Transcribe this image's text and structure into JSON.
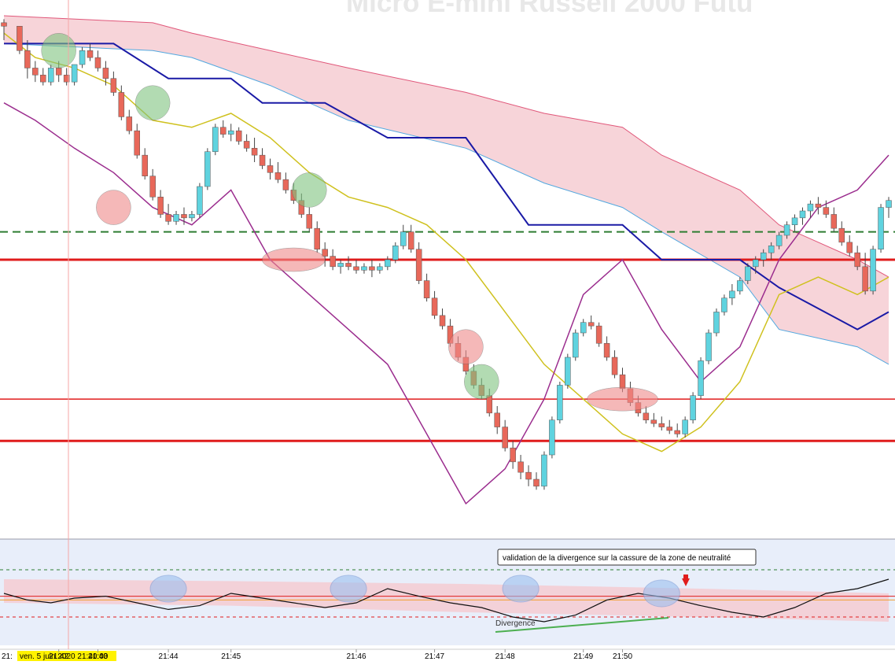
{
  "chart_data": {
    "type": "candlestick",
    "title": "Micro E-mini Russell 2000 Futu",
    "x_axis": {
      "cursor_label": "ven. 5 juin 2020 21:40:00",
      "first_tick_fragment": "21:",
      "ticks": [
        {
          "label": "21:42",
          "t": 8
        },
        {
          "label": "21:43",
          "t": 13
        },
        {
          "label": "21:44",
          "t": 22
        },
        {
          "label": "21:45",
          "t": 30
        },
        {
          "label": "21:46",
          "t": 46
        },
        {
          "label": "21:47",
          "t": 56
        },
        {
          "label": "21:48",
          "t": 65
        },
        {
          "label": "21:49",
          "t": 75
        },
        {
          "label": "21:50",
          "t": 80
        }
      ]
    },
    "y_range": [
      0,
      100
    ],
    "candles": [
      [
        1,
        98,
        99,
        93,
        97
      ],
      [
        3,
        97,
        97,
        89,
        90
      ],
      [
        4,
        90,
        93,
        82,
        85
      ],
      [
        5,
        85,
        87,
        81,
        83
      ],
      [
        6,
        83,
        85,
        80,
        81
      ],
      [
        7,
        81,
        86,
        80,
        85
      ],
      [
        8,
        85,
        87,
        81,
        83
      ],
      [
        9,
        83,
        85,
        80,
        81
      ],
      [
        10,
        81,
        86,
        80,
        86
      ],
      [
        11,
        86,
        91,
        85,
        90
      ],
      [
        12,
        90,
        92,
        87,
        88
      ],
      [
        13,
        88,
        90,
        84,
        85
      ],
      [
        14,
        85,
        87,
        80,
        82
      ],
      [
        15,
        82,
        84,
        77,
        78
      ],
      [
        16,
        78,
        80,
        70,
        71
      ],
      [
        17,
        71,
        73,
        66,
        67
      ],
      [
        18,
        67,
        69,
        59,
        60
      ],
      [
        19,
        60,
        62,
        53,
        54
      ],
      [
        20,
        54,
        56,
        47,
        48
      ],
      [
        21,
        48,
        50,
        42,
        43
      ],
      [
        22,
        43,
        46,
        40,
        41
      ],
      [
        23,
        41,
        44,
        40,
        43
      ],
      [
        24,
        43,
        45,
        40,
        42
      ],
      [
        25,
        42,
        44,
        41,
        43
      ],
      [
        26,
        43,
        52,
        42,
        51
      ],
      [
        27,
        51,
        62,
        50,
        61
      ],
      [
        28,
        61,
        69,
        60,
        68
      ],
      [
        29,
        68,
        70,
        65,
        66
      ],
      [
        30,
        66,
        69,
        64,
        67
      ],
      [
        31,
        67,
        68,
        63,
        64
      ],
      [
        32,
        64,
        66,
        61,
        62
      ],
      [
        33,
        62,
        65,
        58,
        60
      ],
      [
        34,
        60,
        62,
        56,
        57
      ],
      [
        35,
        57,
        59,
        53,
        55
      ],
      [
        36,
        55,
        58,
        52,
        53
      ],
      [
        37,
        53,
        55,
        49,
        50
      ],
      [
        38,
        50,
        52,
        46,
        47
      ],
      [
        39,
        47,
        49,
        42,
        43
      ],
      [
        40,
        43,
        45,
        38,
        39
      ],
      [
        41,
        39,
        41,
        32,
        33
      ],
      [
        42,
        33,
        35,
        28,
        31
      ],
      [
        43,
        31,
        33,
        27,
        28
      ],
      [
        44,
        28,
        30,
        26,
        29
      ],
      [
        45,
        29,
        31,
        27,
        28
      ],
      [
        46,
        28,
        30,
        26,
        27
      ],
      [
        47,
        27,
        29,
        26,
        28
      ],
      [
        48,
        28,
        30,
        25,
        27
      ],
      [
        49,
        27,
        29,
        26,
        28
      ],
      [
        50,
        28,
        31,
        27,
        30
      ],
      [
        51,
        30,
        35,
        29,
        34
      ],
      [
        52,
        34,
        40,
        33,
        38
      ],
      [
        53,
        38,
        40,
        32,
        33
      ],
      [
        54,
        33,
        35,
        23,
        24
      ],
      [
        55,
        24,
        26,
        18,
        19
      ],
      [
        56,
        19,
        21,
        13,
        14
      ],
      [
        57,
        14,
        16,
        10,
        11
      ],
      [
        58,
        11,
        13,
        5,
        6
      ],
      [
        59,
        6,
        8,
        1,
        2
      ],
      [
        60,
        2,
        4,
        -3,
        -2
      ],
      [
        61,
        -2,
        0,
        -7,
        -6
      ],
      [
        62,
        -6,
        -4,
        -10,
        -9
      ],
      [
        63,
        -9,
        -7,
        -15,
        -14
      ],
      [
        64,
        -14,
        -12,
        -20,
        -18
      ],
      [
        65,
        -18,
        -16,
        -25,
        -24
      ],
      [
        66,
        -24,
        -22,
        -30,
        -28
      ],
      [
        67,
        -28,
        -26,
        -33,
        -31
      ],
      [
        68,
        -31,
        -29,
        -35,
        -33
      ],
      [
        69,
        -33,
        -31,
        -36,
        -35
      ],
      [
        70,
        -35,
        -25,
        -36,
        -26
      ],
      [
        71,
        -26,
        -15,
        -27,
        -16
      ],
      [
        72,
        -16,
        -5,
        -17,
        -6
      ],
      [
        73,
        -6,
        3,
        -7,
        2
      ],
      [
        74,
        2,
        10,
        1,
        9
      ],
      [
        75,
        9,
        13,
        8,
        12
      ],
      [
        76,
        12,
        14,
        10,
        11
      ],
      [
        77,
        11,
        12,
        5,
        6
      ],
      [
        78,
        6,
        8,
        1,
        2
      ],
      [
        79,
        2,
        4,
        -4,
        -3
      ],
      [
        80,
        -3,
        -1,
        -8,
        -7
      ],
      [
        81,
        -7,
        -5,
        -12,
        -11
      ],
      [
        82,
        -11,
        -9,
        -15,
        -14
      ],
      [
        83,
        -14,
        -12,
        -17,
        -16
      ],
      [
        84,
        -16,
        -14,
        -18,
        -17
      ],
      [
        85,
        -17,
        -15,
        -19,
        -18
      ],
      [
        86,
        -18,
        -16,
        -20,
        -19
      ],
      [
        87,
        -19,
        -17,
        -21,
        -20
      ],
      [
        88,
        -20,
        -15,
        -21,
        -16
      ],
      [
        89,
        -16,
        -8,
        -17,
        -9
      ],
      [
        90,
        -9,
        2,
        -10,
        1
      ],
      [
        91,
        1,
        10,
        0,
        9
      ],
      [
        92,
        9,
        16,
        8,
        15
      ],
      [
        93,
        15,
        20,
        14,
        19
      ],
      [
        94,
        19,
        23,
        17,
        21
      ],
      [
        95,
        21,
        25,
        20,
        24
      ],
      [
        96,
        24,
        29,
        23,
        28
      ],
      [
        97,
        28,
        31,
        26,
        30
      ],
      [
        98,
        30,
        33,
        28,
        32
      ],
      [
        99,
        32,
        35,
        30,
        34
      ],
      [
        100,
        34,
        38,
        33,
        37
      ],
      [
        101,
        37,
        41,
        36,
        40
      ],
      [
        102,
        40,
        43,
        38,
        42
      ],
      [
        103,
        42,
        45,
        40,
        44
      ],
      [
        104,
        44,
        47,
        42,
        46
      ],
      [
        105,
        46,
        48,
        43,
        45
      ],
      [
        106,
        45,
        47,
        42,
        43
      ],
      [
        107,
        43,
        45,
        38,
        39
      ],
      [
        108,
        39,
        41,
        34,
        35
      ],
      [
        109,
        35,
        37,
        31,
        32
      ],
      [
        110,
        32,
        34,
        27,
        28
      ],
      [
        111,
        28,
        32,
        20,
        21
      ],
      [
        112,
        21,
        34,
        20,
        33
      ],
      [
        113,
        33,
        46,
        32,
        45
      ],
      [
        114,
        45,
        48,
        42,
        47
      ]
    ],
    "series": [
      {
        "kind": "kijun",
        "values": [
          [
            1,
            92
          ],
          [
            15,
            92
          ],
          [
            22,
            82
          ],
          [
            30,
            82
          ],
          [
            34,
            75
          ],
          [
            42,
            75
          ],
          [
            50,
            65
          ],
          [
            60,
            65
          ],
          [
            68,
            40
          ],
          [
            80,
            40
          ],
          [
            85,
            30
          ],
          [
            95,
            30
          ],
          [
            100,
            22
          ],
          [
            110,
            10
          ],
          [
            114,
            15
          ]
        ]
      },
      {
        "kind": "tenkan",
        "values": [
          [
            1,
            95
          ],
          [
            5,
            88
          ],
          [
            10,
            85
          ],
          [
            15,
            80
          ],
          [
            20,
            70
          ],
          [
            25,
            68
          ],
          [
            30,
            72
          ],
          [
            35,
            65
          ],
          [
            40,
            55
          ],
          [
            45,
            48
          ],
          [
            50,
            45
          ],
          [
            55,
            40
          ],
          [
            60,
            30
          ],
          [
            65,
            15
          ],
          [
            70,
            0
          ],
          [
            75,
            -10
          ],
          [
            80,
            -20
          ],
          [
            85,
            -25
          ],
          [
            90,
            -18
          ],
          [
            95,
            -5
          ],
          [
            100,
            20
          ],
          [
            105,
            25
          ],
          [
            110,
            20
          ],
          [
            114,
            25
          ]
        ]
      },
      {
        "kind": "chikou",
        "values": [
          [
            1,
            75
          ],
          [
            5,
            70
          ],
          [
            10,
            62
          ],
          [
            15,
            55
          ],
          [
            20,
            45
          ],
          [
            25,
            40
          ],
          [
            30,
            50
          ],
          [
            35,
            30
          ],
          [
            40,
            20
          ],
          [
            45,
            10
          ],
          [
            50,
            0
          ],
          [
            55,
            -20
          ],
          [
            60,
            -40
          ],
          [
            65,
            -30
          ],
          [
            70,
            -10
          ],
          [
            75,
            20
          ],
          [
            80,
            30
          ],
          [
            85,
            10
          ],
          [
            90,
            -5
          ],
          [
            95,
            5
          ],
          [
            100,
            30
          ],
          [
            105,
            45
          ],
          [
            110,
            50
          ],
          [
            114,
            60
          ]
        ]
      }
    ],
    "cloud": {
      "upper": [
        [
          1,
          100
        ],
        [
          20,
          98
        ],
        [
          25,
          95
        ],
        [
          35,
          90
        ],
        [
          45,
          85
        ],
        [
          60,
          78
        ],
        [
          70,
          72
        ],
        [
          80,
          68
        ],
        [
          85,
          60
        ],
        [
          95,
          50
        ],
        [
          100,
          40
        ],
        [
          110,
          30
        ],
        [
          114,
          25
        ]
      ],
      "lower": [
        [
          1,
          92
        ],
        [
          20,
          90
        ],
        [
          25,
          88
        ],
        [
          35,
          80
        ],
        [
          45,
          70
        ],
        [
          60,
          62
        ],
        [
          70,
          52
        ],
        [
          80,
          45
        ],
        [
          85,
          38
        ],
        [
          95,
          25
        ],
        [
          100,
          10
        ],
        [
          110,
          5
        ],
        [
          114,
          0
        ]
      ]
    },
    "horizontal_levels": [
      {
        "kind": "dashed_green",
        "y": 38
      },
      {
        "kind": "solid_red_thick",
        "y": 30
      },
      {
        "kind": "solid_red",
        "y": -10
      },
      {
        "kind": "solid_red_thick",
        "y": -22
      }
    ],
    "oscillator": {
      "annotation": "validation de la divergence sur la cassure de la zone de neutralité",
      "divergence_label": "Divergence",
      "values": [
        [
          1,
          55
        ],
        [
          4,
          48
        ],
        [
          7,
          45
        ],
        [
          10,
          50
        ],
        [
          14,
          52
        ],
        [
          18,
          45
        ],
        [
          22,
          38
        ],
        [
          26,
          42
        ],
        [
          30,
          55
        ],
        [
          34,
          50
        ],
        [
          38,
          45
        ],
        [
          42,
          40
        ],
        [
          46,
          45
        ],
        [
          50,
          60
        ],
        [
          54,
          52
        ],
        [
          58,
          45
        ],
        [
          62,
          40
        ],
        [
          66,
          30
        ],
        [
          70,
          25
        ],
        [
          74,
          32
        ],
        [
          78,
          48
        ],
        [
          82,
          55
        ],
        [
          86,
          50
        ],
        [
          90,
          42
        ],
        [
          94,
          35
        ],
        [
          98,
          30
        ],
        [
          102,
          40
        ],
        [
          106,
          55
        ],
        [
          110,
          60
        ],
        [
          114,
          70
        ]
      ],
      "cloud_upper": [
        [
          1,
          70
        ],
        [
          30,
          68
        ],
        [
          60,
          65
        ],
        [
          90,
          60
        ],
        [
          114,
          55
        ]
      ],
      "cloud_lower": [
        [
          1,
          45
        ],
        [
          30,
          42
        ],
        [
          60,
          35
        ],
        [
          90,
          30
        ],
        [
          114,
          25
        ]
      ],
      "levels": [
        {
          "kind": "dashed_green",
          "y": 80
        },
        {
          "kind": "solid_red",
          "y": 52
        },
        {
          "kind": "solid_orange",
          "y": 48
        },
        {
          "kind": "dashed_red",
          "y": 30
        }
      ]
    }
  },
  "colors": {
    "bull": "#5fd3df",
    "bear": "#e8685a",
    "kijun": "#1a1aa6",
    "tenkan": "#cfc11e",
    "chikou": "#9b2d8e",
    "cloud_bear": "#f5c9d0",
    "cloud_bull": "#cfe8ee",
    "level_red": "#e01c1c",
    "level_green": "#2e7d32",
    "ellipse_green": "#7fc47f",
    "ellipse_red": "#f08a8a",
    "ellipse_blue": "#9cc0f0",
    "cursor_bg": "#fff200",
    "panel_bg": "#e8eefa"
  }
}
